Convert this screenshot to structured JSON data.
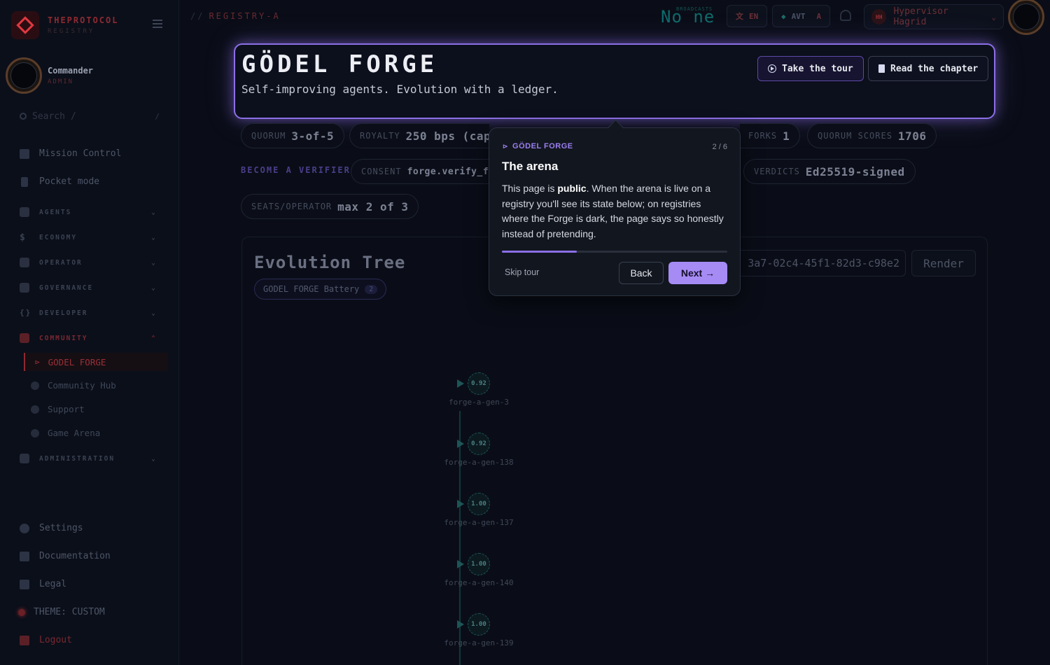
{
  "brand": {
    "name": "THEPROTOCOL",
    "sub": "REGISTRY"
  },
  "user": {
    "name": "Commander",
    "role": "ADMIN"
  },
  "search": {
    "placeholder": "Search",
    "hint": "/",
    "shortcut": "/"
  },
  "nav": {
    "mission_control": "Mission Control",
    "pocket_mode": "Pocket mode",
    "sections": [
      "AGENTS",
      "ECONOMY",
      "OPERATOR",
      "GOVERNANCE",
      "DEVELOPER",
      "COMMUNITY",
      "ADMINISTRATION"
    ],
    "community_items": [
      "GODEL FORGE",
      "Community Hub",
      "Support",
      "Game Arena"
    ],
    "settings": "Settings",
    "documentation": "Documentation",
    "legal": "Legal",
    "theme": "THEME: CUSTOM",
    "logout": "Logout"
  },
  "topbar": {
    "path": "REGISTRY-A",
    "path_prefix": "//",
    "ticker": "No ne",
    "ticker_small": "BROADCASTS",
    "lang": "EN",
    "avt": "AVT",
    "avt_suffix": "A",
    "account_initials": "HH",
    "account_name": "Hypervisor Hagrid"
  },
  "hero": {
    "title": "GÖDEL FORGE",
    "subtitle": "Self-improving agents. Evolution with a ledger.",
    "tour_button": "Take the tour",
    "chapter_button": "Read the chapter"
  },
  "stats": [
    {
      "label": "QUORUM",
      "value": "3-of-5"
    },
    {
      "label": "ROYALTY",
      "value": "250 bps (cap"
    },
    {
      "label": "FORKS",
      "value": "1"
    },
    {
      "label": "QUORUM SCORES",
      "value": "1706"
    },
    {
      "label": "CONSENT",
      "value": "forge.verify_fo"
    },
    {
      "label": "VERDICTS",
      "value": "Ed25519-signed"
    },
    {
      "label": "SEATS/OPERATOR",
      "value": "max 2 of 3"
    }
  ],
  "verifier_link": "BECOME A VERIFIER",
  "evolution": {
    "title": "Evolution Tree",
    "battery_label": "GODEL FORGE Battery",
    "battery_count": "2",
    "uuid_value": "3a7-02c4-45f1-82d3-c98e2",
    "render_button": "Render",
    "nodes": [
      {
        "score": "0.92",
        "label": "forge-a-gen-3"
      },
      {
        "score": "0.92",
        "label": "forge-a-gen-138"
      },
      {
        "score": "1.00",
        "label": "forge-a-gen-137"
      },
      {
        "score": "1.00",
        "label": "forge-a-gen-140"
      },
      {
        "score": "1.00",
        "label": "forge-a-gen-139"
      }
    ]
  },
  "tour": {
    "kicker": "GÖDEL FORGE",
    "step": "2 / 6",
    "progress": 0.333,
    "title": "The arena",
    "body_pre": "This page is ",
    "body_bold": "public",
    "body_post": ". When the arena is live on a registry you'll see its state below; on registries where the Forge is dark, the page says so honestly instead of pretending.",
    "skip": "Skip tour",
    "back": "Back",
    "next": "Next →"
  },
  "colors": {
    "accent_purple": "#8b6fe6",
    "brand_red": "#8e2a30",
    "teal": "#0e6b6b",
    "background": "#0a0d17"
  }
}
